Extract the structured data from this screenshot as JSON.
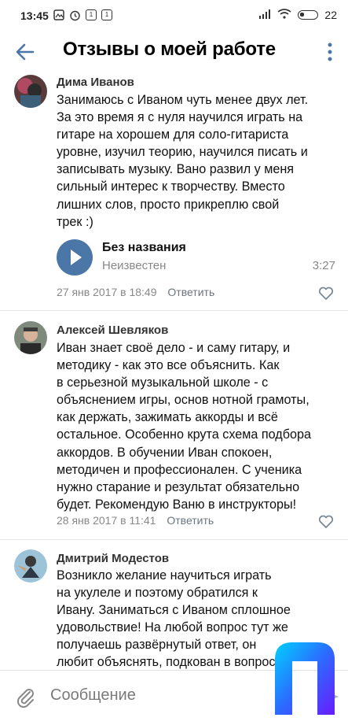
{
  "status_bar": {
    "time": "13:45",
    "battery": "22",
    "left_icon_1": "1",
    "left_icon_2": "1"
  },
  "header": {
    "title": "Отзывы о моей работе"
  },
  "reviews": [
    {
      "author": "Дима Иванов",
      "lines": [
        "Занимаюсь с Иваном чуть менее двух лет.",
        "За это время я с нуля научился играть на",
        "гитаре на хорошем для соло-гитариста",
        "уровне, изучил теорию, научился писать и",
        "записывать музыку. Вано развил у меня",
        "сильный интерес к творчеству. Вместо",
        "лишних слов, просто прикреплю свой",
        "трек :)"
      ],
      "audio": {
        "title": "Без названия",
        "artist": "Неизвестен",
        "duration": "3:27"
      },
      "date": "27 янв 2017 в 18:49",
      "reply": "Ответить"
    },
    {
      "author": "Алексей Шевляков",
      "lines": [
        "Иван знает своё дело - и саму гитару, и",
        "методику - как это все объяснить. Как",
        "в серьезной музыкальной школе - с",
        "объяснением игры, основ нотной грамоты,",
        "как держать, зажимать аккорды и всё",
        "остальное. Особенно крута схема подбора",
        "аккордов. В обучении Иван спокоен,",
        "методичен и профессионален. С ученика",
        "нужно старание и результат обязательно",
        "будет. Рекомендую Ваню в инструкторы!"
      ],
      "date": "28 янв 2017 в 11:41",
      "reply": "Ответить"
    },
    {
      "author": "Дмитрий Модестов",
      "lines": [
        "Возникло желание научиться играть",
        "на укулеле и поэтому обратился к",
        "Ивану. Заниматься с Иваном сплошное",
        "удовольствие! На любой вопрос тут же",
        "получаешь развёрнутый ответ, он",
        "любит объяснять, подкован в вопросах"
      ]
    }
  ],
  "composer": {
    "placeholder": "Сообщение"
  },
  "colors": {
    "accent": "#4a76a8",
    "meta": "#888888",
    "divider": "#e5e5e5"
  }
}
